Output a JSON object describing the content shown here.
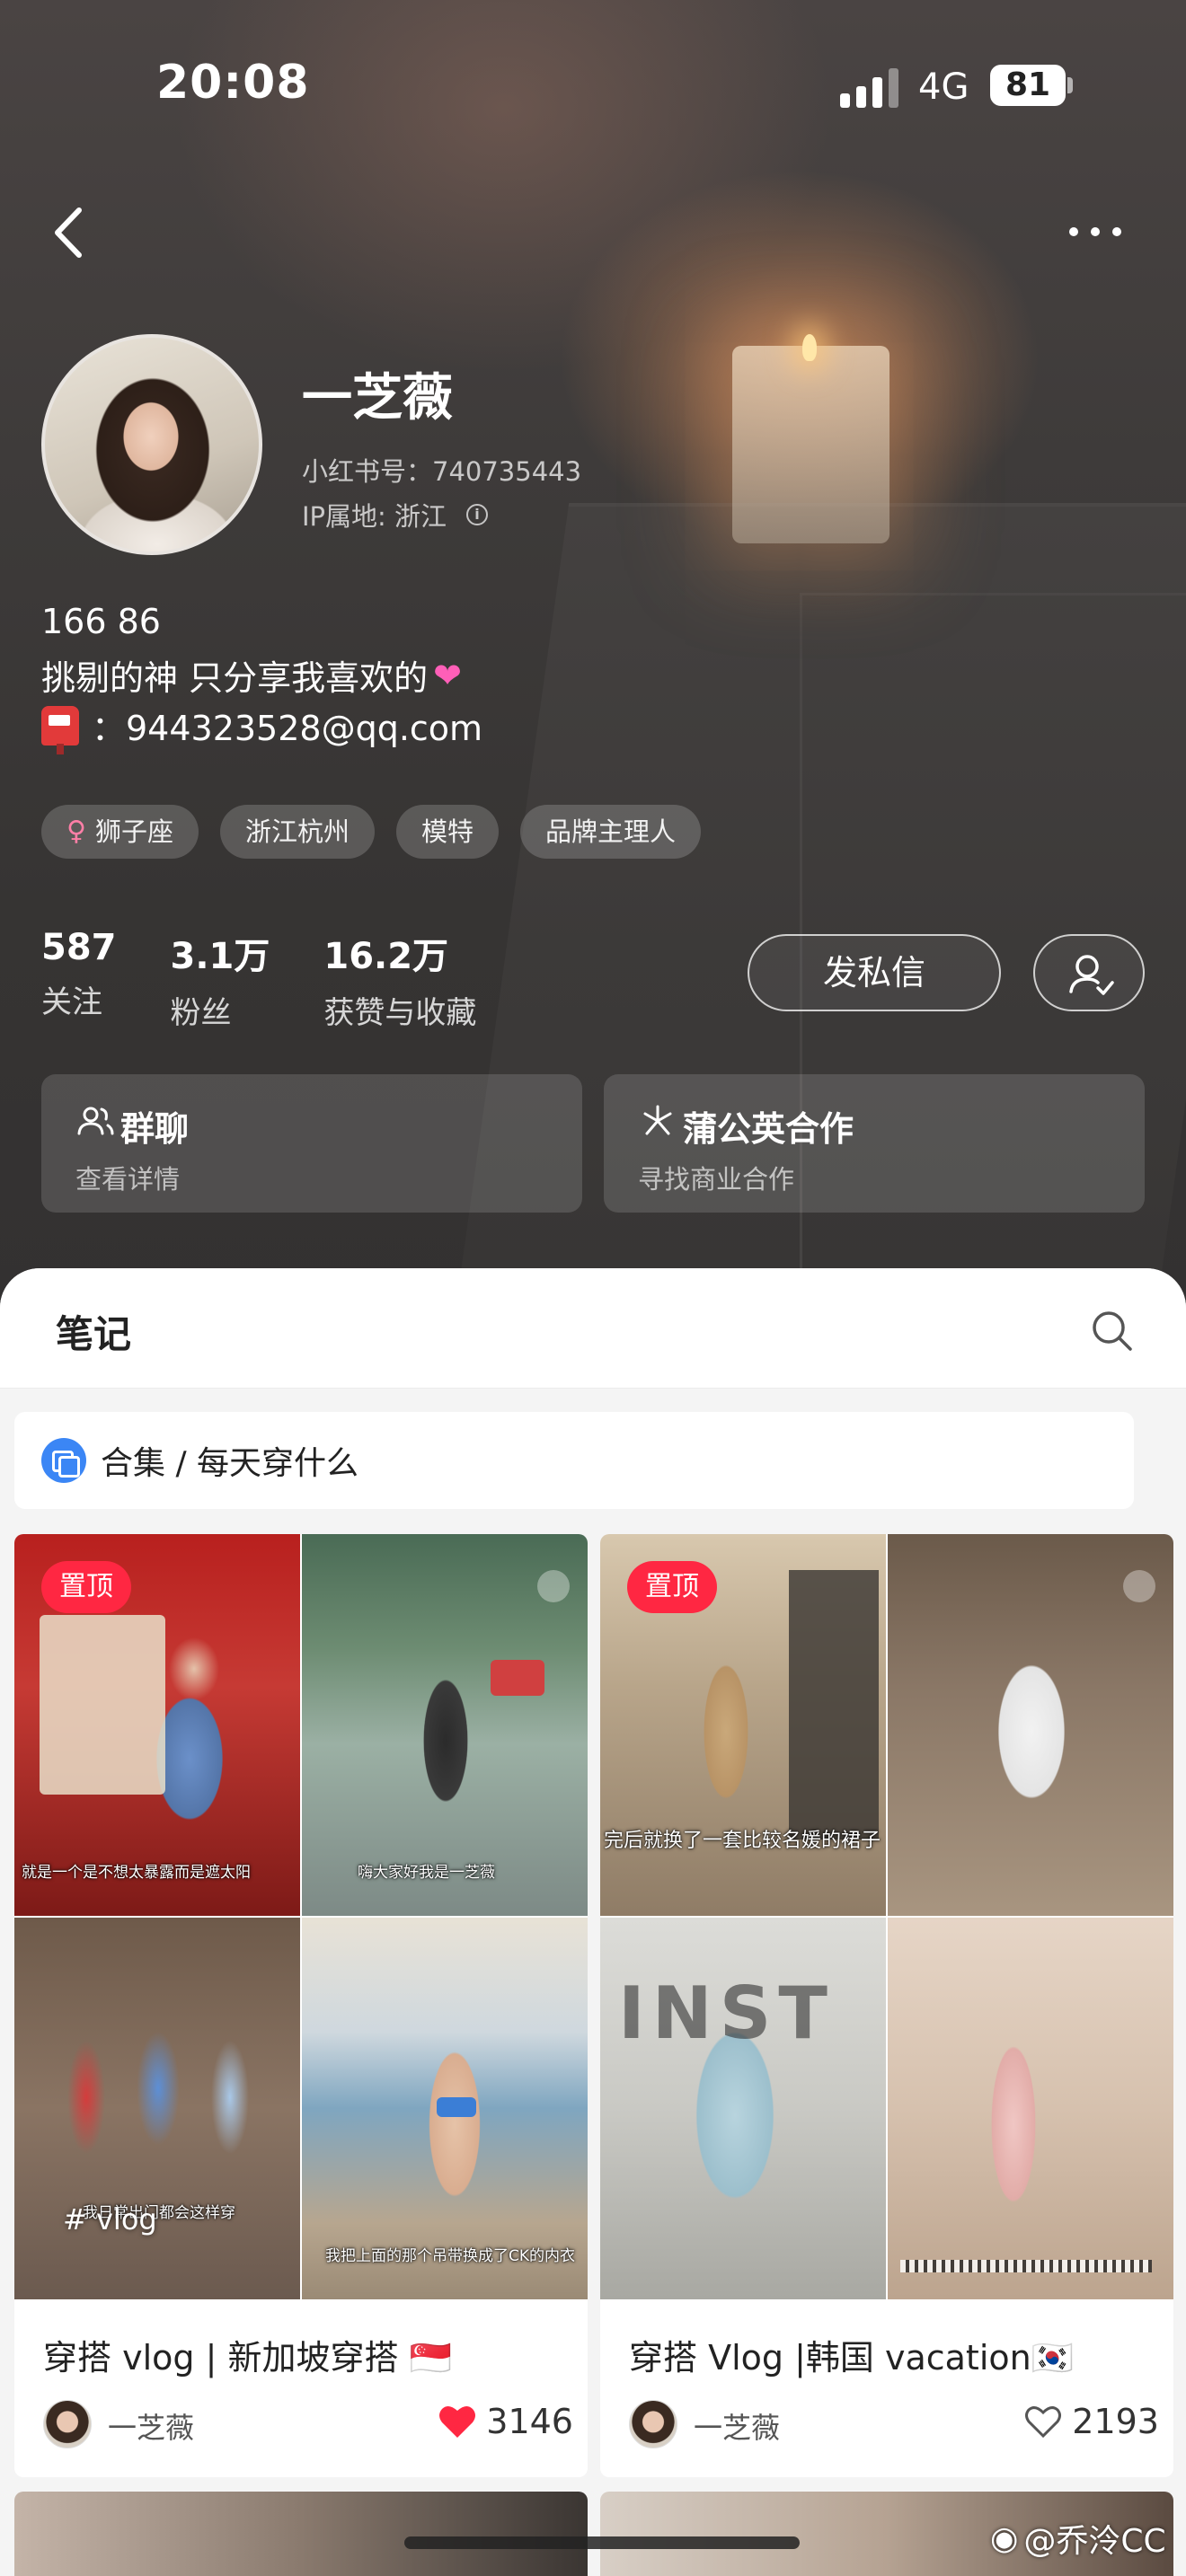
{
  "status_bar": {
    "time": "20:08",
    "network": "4G",
    "battery": "81"
  },
  "profile": {
    "name": "一芝薇",
    "red_id": "小红书号：740735443",
    "ip": "IP属地: 浙江",
    "bio_line1": "166 86",
    "bio_line2": "挑剔的神 只分享我喜欢的",
    "bio_line3": "：944323528@qq.com",
    "tags": [
      "狮子座",
      "浙江杭州",
      "模特",
      "品牌主理人"
    ],
    "stats": [
      {
        "num": "587",
        "label": "关注"
      },
      {
        "num": "3.1万",
        "label": "粉丝"
      },
      {
        "num": "16.2万",
        "label": "获赞与收藏"
      }
    ],
    "message_button": "发私信"
  },
  "cards": {
    "group_chat": {
      "title": "群聊",
      "sub": "查看详情"
    },
    "dandelion": {
      "title": "蒲公英合作",
      "sub": "寻找商业合作"
    }
  },
  "notes_panel": {
    "tab": "笔记",
    "collection": "合集 / 每天穿什么",
    "notes": [
      {
        "pin": "置顶",
        "tag": "# vlog",
        "captions": [
          "就是一个是不想太暴露而是遮太阳",
          "嗨大家好我是一芝薇",
          "我日常出门都会这样穿",
          "我把上面的那个吊带换成了CK的内衣"
        ],
        "title": "穿搭 vlog | 新加坡穿搭 🇸🇬",
        "author": "一芝薇",
        "likes": "3146"
      },
      {
        "pin": "置顶",
        "captions": [
          "完后就换了一套比较名媛的裙子"
        ],
        "title": "穿搭 Vlog |韩国 vacation🇰🇷",
        "author": "一芝薇",
        "likes": "2193"
      }
    ]
  },
  "watermark": "@乔泠CC",
  "colors": {
    "accent": "#ff2742",
    "like": "#ff2742",
    "collection": "#3b86f5"
  }
}
